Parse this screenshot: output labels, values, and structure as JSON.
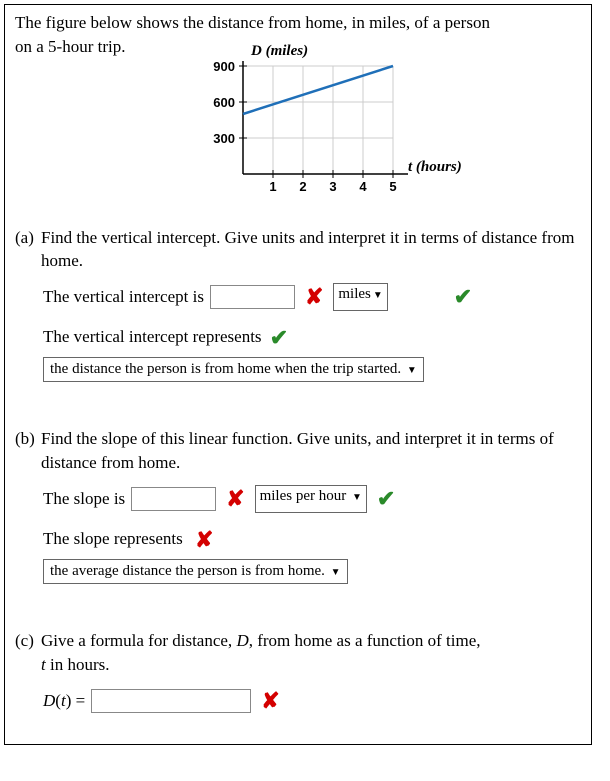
{
  "intro": {
    "line1": "The figure below shows the distance from home, in miles, of a person",
    "line2": "on a 5-hour trip."
  },
  "chart_data": {
    "type": "line",
    "title": "",
    "xlabel": "t (hours)",
    "ylabel": "D (miles)",
    "x_ticks": [
      1,
      2,
      3,
      4,
      5
    ],
    "y_ticks": [
      300,
      600,
      900
    ],
    "xlim": [
      0,
      5
    ],
    "ylim": [
      0,
      900
    ],
    "series": [
      {
        "name": "distance",
        "x": [
          0,
          5
        ],
        "y": [
          500,
          900
        ]
      }
    ]
  },
  "ticks": {
    "t1": "1",
    "t2": "2",
    "t3": "3",
    "t4": "4",
    "t5": "5",
    "y300": "300",
    "y600": "600",
    "y900": "900"
  },
  "partA": {
    "label": "(a)",
    "prompt": "Find the vertical intercept. Give units and interpret it in terms of distance from home.",
    "lead": "The vertical intercept is",
    "input_value": "",
    "units_selected": "miles",
    "input_mark": "wrong",
    "units_mark": "correct",
    "interpret_lead": "The vertical intercept represents",
    "interpret_mark": "correct",
    "interpret_selected": "the distance the person is from home when the trip started."
  },
  "partB": {
    "label": "(b)",
    "prompt": "Find the slope of this linear function. Give units, and interpret it in terms of distance from home.",
    "lead": "The slope is",
    "input_value": "",
    "units_selected": "miles per hour",
    "input_mark": "wrong",
    "units_mark": "correct",
    "interpret_lead": "The slope represents",
    "interpret_mark": "wrong",
    "interpret_selected": "the average distance the person is from home."
  },
  "partC": {
    "label": "(c)",
    "prompt_a": "Give a formula for distance, ",
    "prompt_D": "D",
    "prompt_b": ", from home as a function of time,",
    "prompt_t": "t",
    "prompt_c": " in hours.",
    "func_left_D": "D",
    "func_left_open": "(",
    "func_left_t": "t",
    "func_left_close": ") =",
    "input_value": "",
    "input_mark": "wrong"
  },
  "marks": {
    "correct_glyph": "✔",
    "wrong_glyph": "✘"
  }
}
